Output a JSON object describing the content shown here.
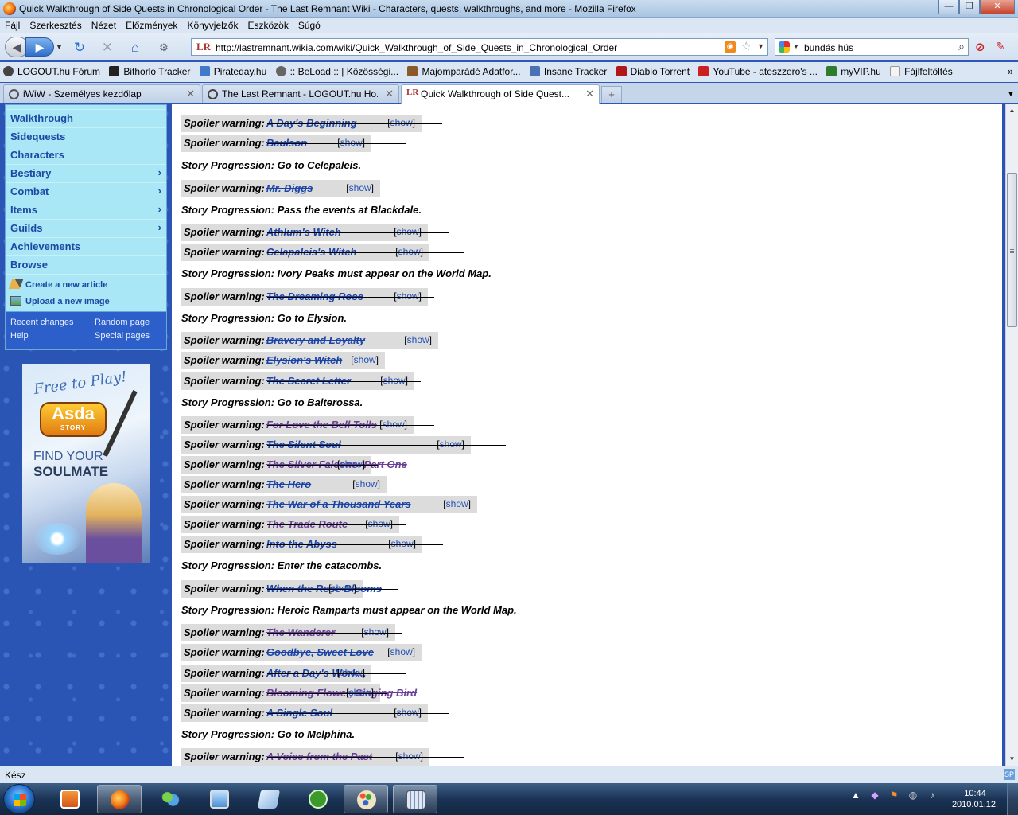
{
  "window": {
    "title": "Quick Walkthrough of Side Quests in Chronological Order - The Last Remnant Wiki - Characters, quests, walkthroughs, and more - Mozilla Firefox",
    "minimize": "—",
    "maximize": "❐",
    "close": "✕"
  },
  "menu": [
    "Fájl",
    "Szerkesztés",
    "Nézet",
    "Előzmények",
    "Könyvjelzők",
    "Eszközök",
    "Súgó"
  ],
  "navbar": {
    "url": "http://lastremnant.wikia.com/wiki/Quick_Walkthrough_of_Side_Quests_in_Chronological_Order",
    "site_icon_text": "LR",
    "search_query": "bundás hús"
  },
  "bookmarks": [
    {
      "label": "LOGOUT.hu Fórum",
      "color": "#444444"
    },
    {
      "label": "Bithorlo Tracker",
      "color": "#222222"
    },
    {
      "label": "Pirateday.hu",
      "color": "#3f79c8"
    },
    {
      "label": ":: BeLoad :: | Közösségi...",
      "color": "#666666"
    },
    {
      "label": "Majomparádé Adatfor...",
      "color": "#8a5a2b"
    },
    {
      "label": "Insane Tracker",
      "color": "#4a73b5"
    },
    {
      "label": "Diablo Torrent",
      "color": "#b01818"
    },
    {
      "label": "YouTube - ateszzero's ...",
      "color": "#cc2020"
    },
    {
      "label": "myVIP.hu",
      "color": "#2d7d2d"
    },
    {
      "label": "Fájlfeltöltés",
      "color": "#eeeeee"
    }
  ],
  "tabs": [
    {
      "label": "iWiW - Személyes kezdőlap",
      "close": "✕"
    },
    {
      "label": "The Last Remnant - LOGOUT.hu Ho...",
      "close": "✕"
    },
    {
      "label": "Quick Walkthrough of Side Quest...",
      "close": "✕"
    }
  ],
  "sidebar": {
    "items": [
      {
        "label": "Walkthrough",
        "chevron": ""
      },
      {
        "label": "Sidequests",
        "chevron": ""
      },
      {
        "label": "Characters",
        "chevron": ""
      },
      {
        "label": "Bestiary",
        "chevron": "›"
      },
      {
        "label": "Combat",
        "chevron": "›"
      },
      {
        "label": "Items",
        "chevron": "›"
      },
      {
        "label": "Guilds",
        "chevron": "›"
      },
      {
        "label": "Achievements",
        "chevron": ""
      },
      {
        "label": "Browse",
        "chevron": ""
      }
    ],
    "actions": [
      "Create a new article",
      "Upload a new image"
    ],
    "links": [
      "Recent changes",
      "Random page",
      "Help",
      "Special pages"
    ]
  },
  "ad": {
    "line1": "Free to Play!",
    "logo": "Asda",
    "logo_sub": "STORY",
    "line2": "FIND YOUR",
    "line3": "SOULMATE"
  },
  "content": {
    "spoiler_label": "Spoiler warning:",
    "show_text": "show",
    "rows": [
      {
        "kind": "spoiler",
        "quest": "A Day's Beginning",
        "visited": false
      },
      {
        "kind": "spoiler",
        "quest": "Baulson",
        "visited": false
      },
      {
        "kind": "story",
        "text": "Story Progression: Go to Celepaleis."
      },
      {
        "kind": "spoiler",
        "quest": "Mr. Diggs",
        "visited": false
      },
      {
        "kind": "story",
        "text": "Story Progression: Pass the events at Blackdale."
      },
      {
        "kind": "spoiler",
        "quest": "Athlum's Witch",
        "visited": false
      },
      {
        "kind": "spoiler",
        "quest": "Celapaleis's Witch",
        "visited": false
      },
      {
        "kind": "story",
        "text": "Story Progression: Ivory Peaks must appear on the World Map."
      },
      {
        "kind": "spoiler",
        "quest": "The Dreaming Rose",
        "visited": false
      },
      {
        "kind": "story",
        "text": "Story Progression: Go to Elysion."
      },
      {
        "kind": "spoiler",
        "quest": "Bravery and Loyalty",
        "visited": false
      },
      {
        "kind": "spoiler",
        "quest": "Elysion's Witch",
        "visited": false
      },
      {
        "kind": "spoiler",
        "quest": "The Secret Letter",
        "visited": false
      },
      {
        "kind": "story",
        "text": "Story Progression: Go to Balterossa."
      },
      {
        "kind": "spoiler",
        "quest": "For Love the Bell Tolls",
        "visited": true
      },
      {
        "kind": "spoiler",
        "quest": "The Silent Soul",
        "visited": false
      },
      {
        "kind": "spoiler",
        "quest": "The Silver Falcons: Part One",
        "visited": true
      },
      {
        "kind": "spoiler",
        "quest": "The Hero",
        "visited": false
      },
      {
        "kind": "spoiler",
        "quest": "The War of a Thousand Years",
        "visited": false
      },
      {
        "kind": "spoiler",
        "quest": "The Trade Route",
        "visited": true
      },
      {
        "kind": "spoiler",
        "quest": "Into the Abyss",
        "visited": false
      },
      {
        "kind": "story",
        "text": "Story Progression: Enter the catacombs."
      },
      {
        "kind": "spoiler",
        "quest": "When the Rose Blooms",
        "visited": false
      },
      {
        "kind": "story",
        "text": "Story Progression: Heroic Ramparts must appear on the World Map."
      },
      {
        "kind": "spoiler",
        "quest": "The Wanderer",
        "visited": true
      },
      {
        "kind": "spoiler",
        "quest": "Goodbye, Sweet Love",
        "visited": false
      },
      {
        "kind": "spoiler",
        "quest": "After a Day's Work...",
        "visited": false
      },
      {
        "kind": "spoiler",
        "quest": "Blooming Flower, Singing Bird",
        "visited": true
      },
      {
        "kind": "spoiler",
        "quest": "A Single Soul",
        "visited": false
      },
      {
        "kind": "story",
        "text": "Story Progression: Go to Melphina."
      },
      {
        "kind": "spoiler",
        "quest": "A Voice from the Past",
        "visited": true
      }
    ]
  },
  "status": {
    "text": "Kész",
    "addon": "SP"
  },
  "taskbar": {
    "time": "10:44",
    "date": "2010.01.12."
  }
}
